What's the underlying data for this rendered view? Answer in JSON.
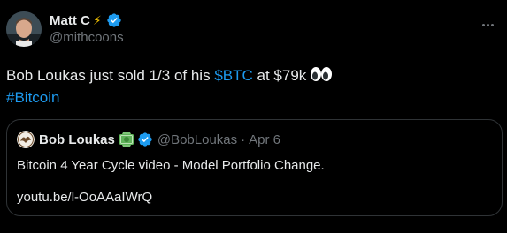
{
  "tweet": {
    "author": {
      "name": "Matt C",
      "name_emoji": "⚡",
      "handle": "@mithcoons",
      "avatar_icon": "avatar-photo"
    },
    "text": {
      "part1": "Bob Loukas just sold 1/3 of his ",
      "cashtag": "$BTC",
      "part2": " at $79k",
      "hashtag": "#Bitcoin"
    },
    "more_icon": "more-options-icon"
  },
  "quote": {
    "author": {
      "name": "Bob Loukas",
      "handle": "@BobLoukas",
      "separator": "·",
      "date": "Apr 6"
    },
    "text": "Bitcoin 4 Year Cycle video - Model Portfolio Change.",
    "link": "youtu.be/l-OoAAaIWrQ"
  },
  "colors": {
    "background": "#000000",
    "text": "#e7e9ea",
    "secondary": "#71767b",
    "link": "#1d9bf0",
    "border": "#2f3336",
    "verified": "#1d9bf0"
  }
}
